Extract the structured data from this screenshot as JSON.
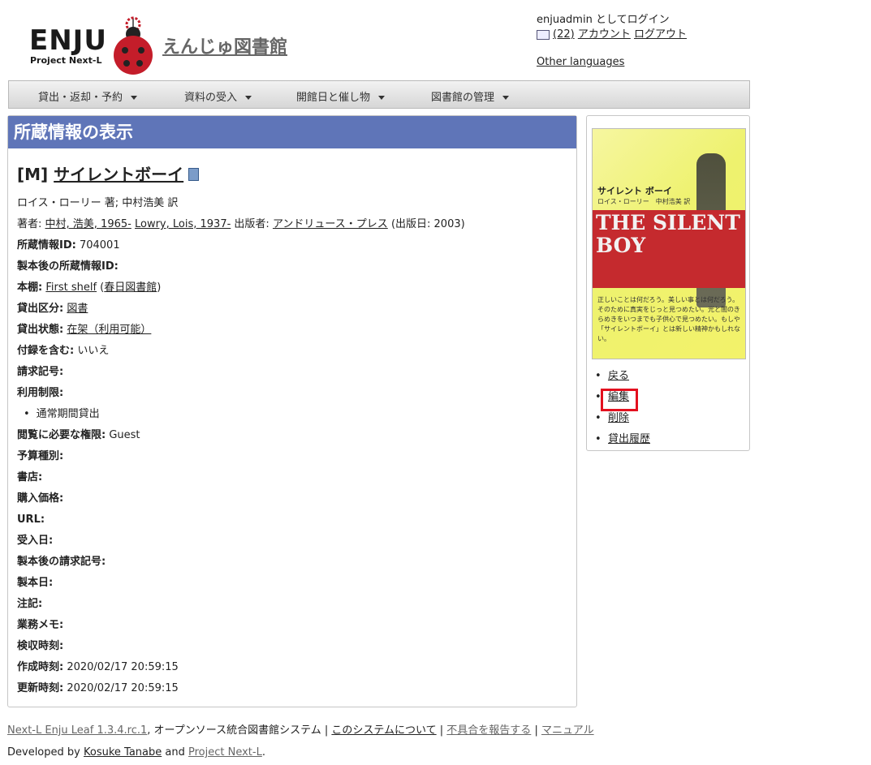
{
  "header": {
    "logo_text": "ENJU",
    "logo_sub": "Project Next-L",
    "site_title": "えんじゅ図書館",
    "login_status": "enjuadmin としてログイン",
    "message_count": "(22)",
    "account_link": "アカウント",
    "logout_link": "ログアウト",
    "other_languages": "Other languages"
  },
  "nav": {
    "items": [
      {
        "label": "貸出・返却・予約"
      },
      {
        "label": "資料の受入"
      },
      {
        "label": "開館日と催し物"
      },
      {
        "label": "図書館の管理"
      }
    ]
  },
  "main": {
    "panel_title": "所蔵情報の表示",
    "item_prefix": "[M]",
    "item_title": "サイレントボーイ",
    "responsibility": "ロイス・ローリー 著; 中村浩美 訳",
    "creators_label": "著者:",
    "creator1": "中村, 浩美, 1965-",
    "creator2": "Lowry, Lois, 1937-",
    "publisher_label": "出版者:",
    "publisher": "アンドリュース・プレス",
    "pub_date": "(出版日: 2003)",
    "fields": {
      "item_id_label": "所蔵情報ID:",
      "item_id": "704001",
      "binding_item_id_label": "製本後の所蔵情報ID:",
      "shelf_label": "本棚:",
      "shelf": "First shelf",
      "library": "春日図書館",
      "checkout_type_label": "貸出区分:",
      "checkout_type": "図書",
      "circulation_status_label": "貸出状態:",
      "circulation_status": "在架（利用可能）",
      "include_supplements_label": "付録を含む:",
      "include_supplements": "いいえ",
      "call_number_label": "請求記号:",
      "use_restriction_label": "利用制限:",
      "use_restriction": "通常期間貸出",
      "required_role_label": "閲覧に必要な権限:",
      "required_role": "Guest",
      "budget_type_label": "予算種別:",
      "bookstore_label": "書店:",
      "price_label": "購入価格:",
      "url_label": "URL:",
      "acquired_at_label": "受入日:",
      "binding_call_number_label": "製本後の請求記号:",
      "binded_at_label": "製本日:",
      "note_label": "注記:",
      "memo_label": "業務メモ:",
      "missing_since_label": "検収時刻:",
      "created_at_label": "作成時刻:",
      "created_at": "2020/02/17 20:59:15",
      "updated_at_label": "更新時刻:",
      "updated_at": "2020/02/17 20:59:15"
    }
  },
  "side": {
    "cover": {
      "jp_title": "サイレント ボーイ",
      "jp_author": "ロイス・ローリー　中村浩美 訳",
      "en_title": "THE SILENT BOY",
      "blurb": "正しいことは何だろう。美しい事とは何だろう。そのために真実をじっと見つめたい。光と闇のきらめきをいつまでも子供心で見つめたい。もしや「サイレントボーイ」とは新しい精神かもしれない。"
    },
    "links": [
      {
        "label": "戻る"
      },
      {
        "label": "編集"
      },
      {
        "label": "削除"
      },
      {
        "label": "貸出履歴"
      }
    ],
    "highlight_color": "#e3101f"
  },
  "footer": {
    "product": "Next-L Enju Leaf 1.3.4.rc.1",
    "product_desc": ", オープンソース統合図書館システム",
    "about": "このシステムについて",
    "report": "不具合を報告する",
    "manual": "マニュアル",
    "developed_by": "Developed by",
    "developer": "Kosuke Tanabe",
    "and": "and",
    "org": "Project Next-L",
    "period": "."
  },
  "colors": {
    "title_bar": "#5f75b8",
    "navbar": "#e0e0e0"
  }
}
